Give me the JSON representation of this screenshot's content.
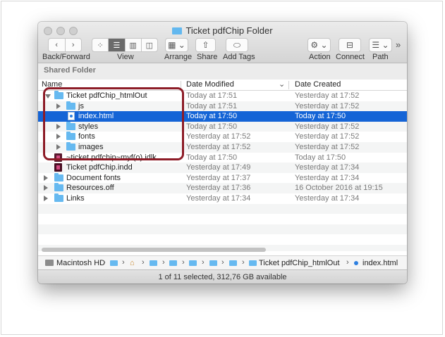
{
  "window": {
    "title": "Ticket pdfChip Folder"
  },
  "toolbar": {
    "back_forward_label": "Back/Forward",
    "view_label": "View",
    "arrange_label": "Arrange",
    "share_label": "Share",
    "add_tags_label": "Add Tags",
    "action_label": "Action",
    "connect_label": "Connect",
    "path_label": "Path",
    "overflow": "»"
  },
  "sidebar_header": "Shared Folder",
  "columns": {
    "name": "Name",
    "date_modified": "Date Modified",
    "date_created": "Date Created"
  },
  "rows": [
    {
      "name": "Ticket pdfChip_htmlOut",
      "modified": "Today at 17:51",
      "created": "Yesterday at 17:52",
      "level": 0,
      "kind": "folder",
      "expanded": true
    },
    {
      "name": "js",
      "modified": "Today at 17:51",
      "created": "Yesterday at 17:52",
      "level": 1,
      "kind": "folder",
      "expanded": false
    },
    {
      "name": "index.html",
      "modified": "Today at 17:50",
      "created": "Today at 17:50",
      "level": 1,
      "kind": "html",
      "selected": true
    },
    {
      "name": "styles",
      "modified": "Today at 17:50",
      "created": "Yesterday at 17:52",
      "level": 1,
      "kind": "folder",
      "expanded": false
    },
    {
      "name": "fonts",
      "modified": "Yesterday at 17:52",
      "created": "Yesterday at 17:52",
      "level": 1,
      "kind": "folder",
      "expanded": false
    },
    {
      "name": "images",
      "modified": "Yesterday at 17:52",
      "created": "Yesterday at 17:52",
      "level": 1,
      "kind": "folder",
      "expanded": false
    },
    {
      "name": "~ticket pdfchip~myf(o).idlk",
      "modified": "Today at 17:50",
      "created": "Today at 17:50",
      "level": 0,
      "kind": "file"
    },
    {
      "name": "Ticket pdfChip.indd",
      "modified": "Yesterday at 17:49",
      "created": "Yesterday at 17:34",
      "level": 0,
      "kind": "indd"
    },
    {
      "name": "Document fonts",
      "modified": "Yesterday at 17:37",
      "created": "Yesterday at 17:34",
      "level": 0,
      "kind": "folder",
      "expanded": false
    },
    {
      "name": "Resources.off",
      "modified": "Yesterday at 17:36",
      "created": "16 October 2016 at 19:15",
      "level": 0,
      "kind": "folder",
      "expanded": false
    },
    {
      "name": "Links",
      "modified": "Yesterday at 17:34",
      "created": "Yesterday at 17:34",
      "level": 0,
      "kind": "folder",
      "expanded": false
    }
  ],
  "breadcrumb": {
    "root": "Macintosh HD",
    "folder": "Ticket pdfChip_htmlOut",
    "file": "index.html",
    "separator": "›"
  },
  "status": "1 of 11 selected, 312,76 GB available",
  "colors": {
    "selection": "#1464d6",
    "folder": "#66b9f0",
    "highlight_border": "#8d1c27"
  }
}
